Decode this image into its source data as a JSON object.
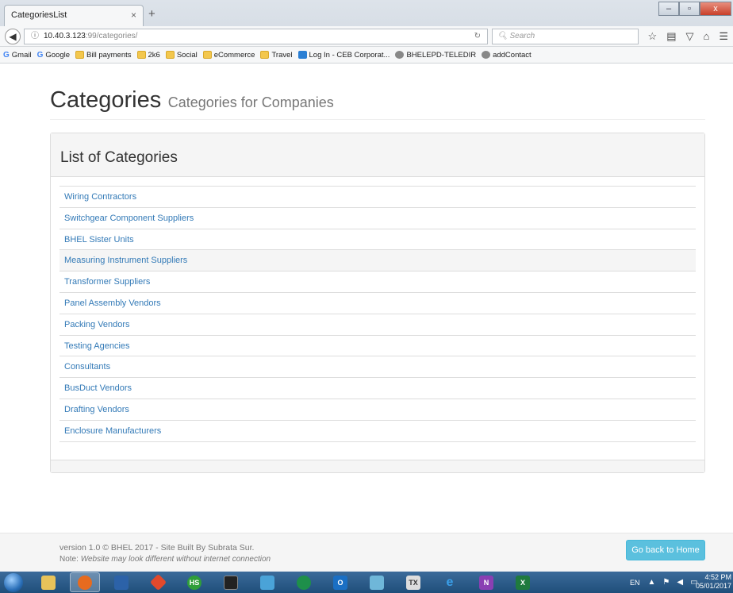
{
  "browser": {
    "tab_title": "CategoriesList",
    "tab_close": "×",
    "new_tab": "+",
    "url_host": "10.40.3.123",
    "url_rest": ":99/categories/",
    "search_placeholder": "Search",
    "bookmarks": [
      {
        "label": "Gmail",
        "icon": "google"
      },
      {
        "label": "Google",
        "icon": "google"
      },
      {
        "label": "Bill payments",
        "icon": "folder"
      },
      {
        "label": "2k6",
        "icon": "folder"
      },
      {
        "label": "Social",
        "icon": "folder"
      },
      {
        "label": "eCommerce",
        "icon": "folder"
      },
      {
        "label": "Travel",
        "icon": "folder"
      },
      {
        "label": "Log In - CEB Corporat...",
        "icon": "page"
      },
      {
        "label": "BHELEPD-TELEDIR",
        "icon": "globe"
      },
      {
        "label": "addContact",
        "icon": "globe"
      }
    ]
  },
  "page": {
    "title": "Categories",
    "subtitle": "Categories for Companies",
    "panel_title": "List of Categories",
    "categories": [
      "Wiring Contractors",
      "Switchgear Component Suppliers",
      "BHEL Sister Units",
      "Measuring Instrument Suppliers",
      "Transformer Suppliers",
      "Panel Assembly Vendors",
      "Packing Vendors",
      "Testing Agencies",
      "Consultants",
      "BusDuct Vendors",
      "Drafting Vendors",
      "Enclosure Manufacturers"
    ],
    "highlighted_index": 3
  },
  "footer": {
    "version": "version 1.0 © BHEL 2017 - Site Built By Subrata Sur.",
    "note_label": "Note:",
    "note_text": "Website may look different without internet connection",
    "home_button": "Go back to Home"
  },
  "taskbar": {
    "lang": "EN",
    "time": "4:52 PM",
    "date": "05/01/2017"
  },
  "colors": {
    "link": "#337ab7",
    "info_button": "#5bc0de"
  }
}
